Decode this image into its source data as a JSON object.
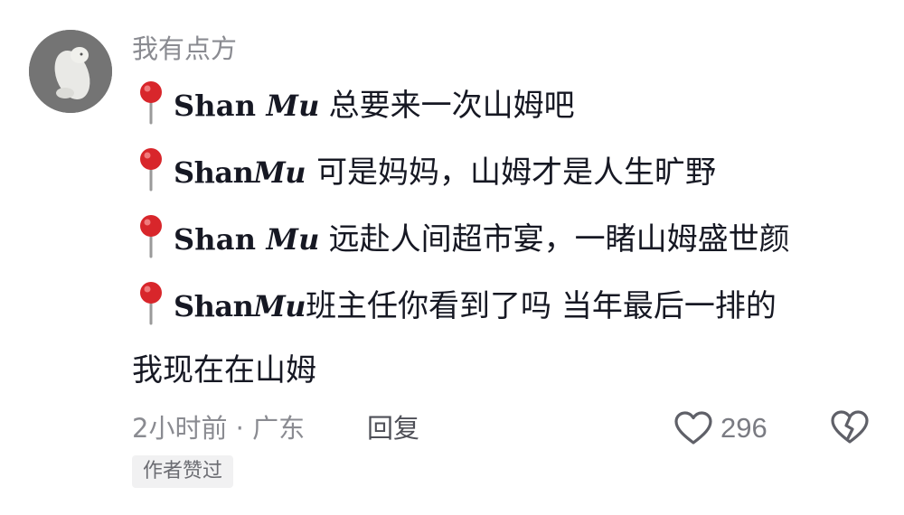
{
  "comment": {
    "username": "我有点方",
    "lines": [
      {
        "brand_a": "Shan ",
        "brand_b": "Mu",
        "text": "总要来一次山姆吧"
      },
      {
        "brand_a": "Shan",
        "brand_b": "Mu",
        "text": "可是妈妈，山姆才是人生旷野"
      },
      {
        "brand_a": "Shan ",
        "brand_b": "Mu",
        "text": "远赴人间超市宴，一睹山姆盛世颜"
      },
      {
        "brand_a": "Shan",
        "brand_b": "Mu",
        "text": "班主任你看到了吗 当年最后一排的"
      }
    ],
    "continuation": "我现在在山姆",
    "meta": "2小时前 · 广东",
    "reply_label": "回复",
    "like_count": "296",
    "badge": "作者赞过",
    "icons": {
      "pin": "round-pushpin-icon",
      "like": "heart-outline-icon",
      "dislike": "broken-heart-icon"
    },
    "colors": {
      "pin_red": "#d8262b",
      "meta_gray": "#8a8b91",
      "text_dark": "#161823"
    }
  }
}
